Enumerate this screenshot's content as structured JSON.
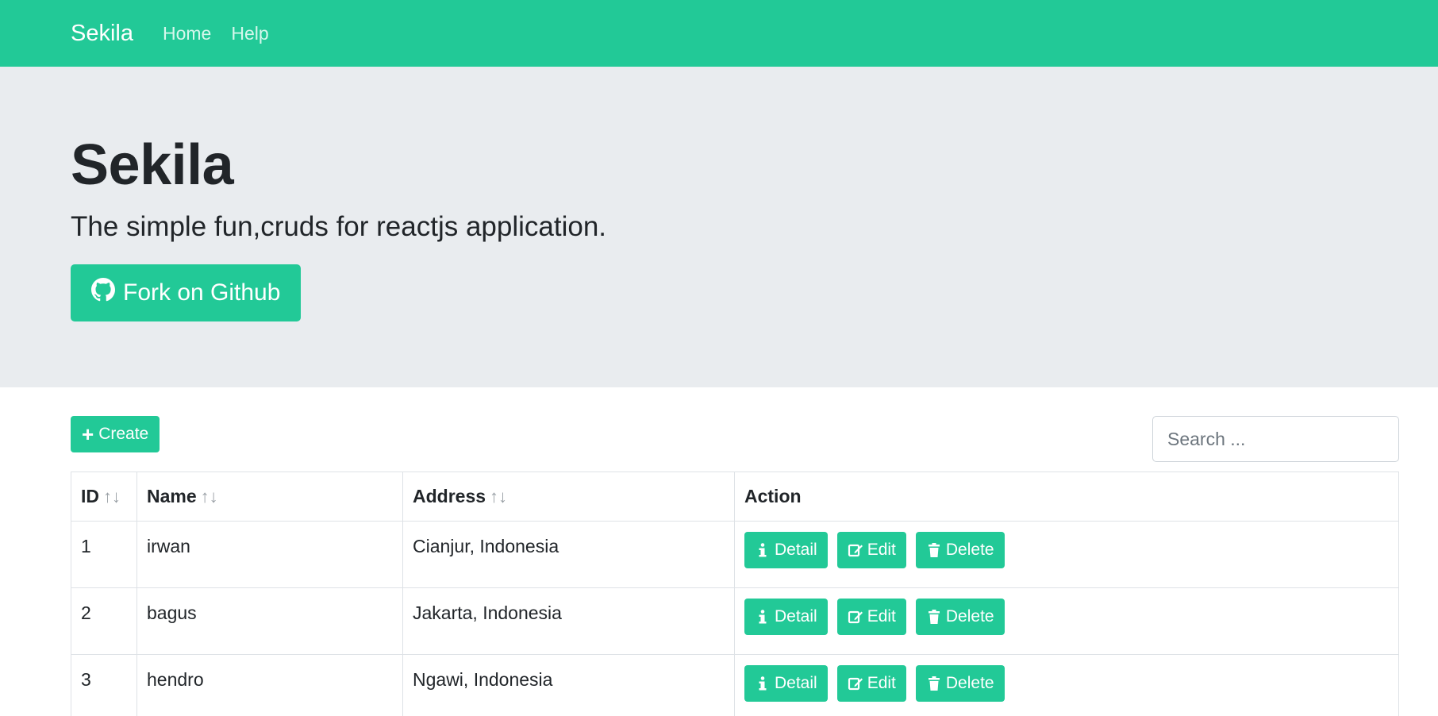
{
  "navbar": {
    "brand": "Sekila",
    "links": [
      "Home",
      "Help"
    ]
  },
  "hero": {
    "title": "Sekila",
    "lead": "The simple fun,cruds for reactjs application.",
    "button_label": "Fork on Github",
    "button_icon": "github-icon"
  },
  "toolbar": {
    "create_label": "Create",
    "create_icon": "plus-icon",
    "search_placeholder": "Search ..."
  },
  "table": {
    "columns": [
      "ID",
      "Name",
      "Address",
      "Action"
    ],
    "sort_glyph": "↑↓",
    "rows": [
      {
        "id": "1",
        "name": "irwan",
        "address": "Cianjur, Indonesia"
      },
      {
        "id": "2",
        "name": "bagus",
        "address": "Jakarta, Indonesia"
      },
      {
        "id": "3",
        "name": "hendro",
        "address": "Ngawi, Indonesia"
      }
    ],
    "actions": {
      "detail": "Detail",
      "edit": "Edit",
      "delete": "Delete"
    }
  },
  "colors": {
    "accent": "#22c997",
    "hero_bg": "#e9ecef",
    "nav_link": "#d6f7ec"
  }
}
